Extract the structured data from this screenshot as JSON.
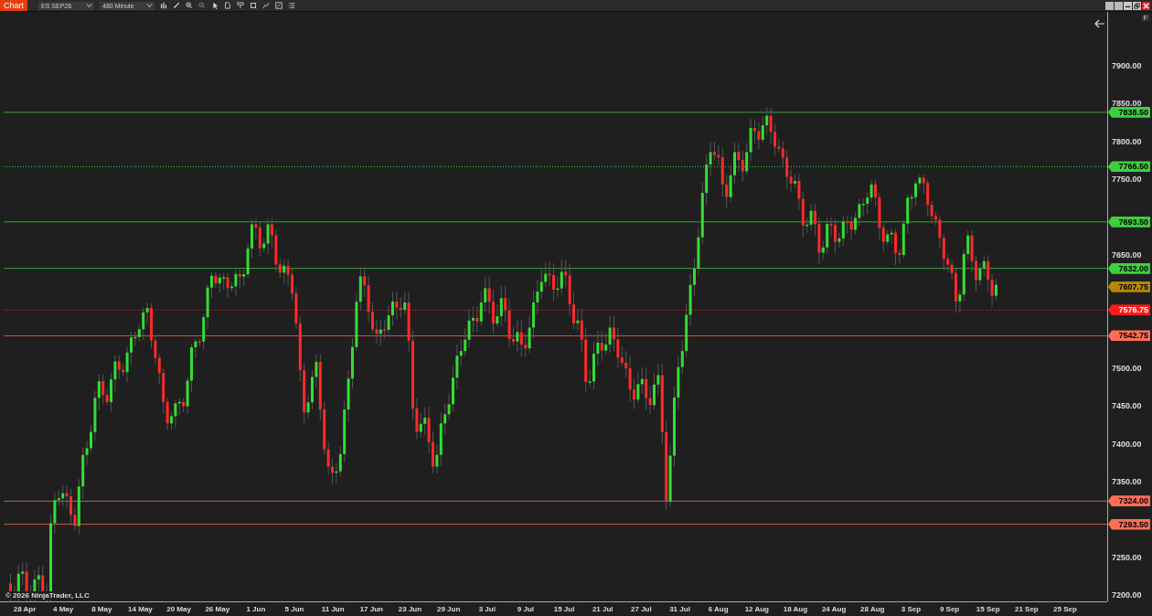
{
  "toolbar": {
    "tab": "Chart",
    "instrument": "ES SEP26",
    "interval": "480 Minute"
  },
  "chart": {
    "flag": "F",
    "price_axis": [
      "7900.00",
      "7850.00",
      "7800.00",
      "7750.00",
      "7650.00",
      "7500.00",
      "7450.00",
      "7400.00",
      "7350.00",
      "7250.00",
      "7200.00"
    ],
    "levels": [
      {
        "label": "7838.50",
        "color": "#3ecf3e",
        "kind": "solid"
      },
      {
        "label": "7766.50",
        "color": "#3ecf3e",
        "kind": "dotted"
      },
      {
        "label": "7693.50",
        "color": "#3ecf3e",
        "kind": "solid"
      },
      {
        "label": "7632.00",
        "color": "#3ecf3e",
        "kind": "solid"
      },
      {
        "label": "7576.75",
        "color": "#ff1a1a",
        "kind": "dotted"
      },
      {
        "label": "7542.75",
        "color": "#ff6e55",
        "kind": "solid"
      },
      {
        "label": "7324.00",
        "color": "#ff6e55",
        "kind": "solid"
      },
      {
        "label": "7293.50",
        "color": "#ff6e55",
        "kind": "solid"
      }
    ],
    "last_price": {
      "label": "7607.75",
      "color": "#b8860b"
    },
    "date_axis": [
      "28 Apr",
      "4 May",
      "8 May",
      "14 May",
      "20 May",
      "26 May",
      "1 Jun",
      "5 Jun",
      "11 Jun",
      "17 Jun",
      "23 Jun",
      "29 Jun",
      "3 Jul",
      "9 Jul",
      "15 Jul",
      "21 Jul",
      "27 Jul",
      "31 Jul",
      "6 Aug",
      "12 Aug",
      "18 Aug",
      "24 Aug",
      "28 Aug",
      "3 Sep",
      "9 Sep",
      "15 Sep",
      "21 Sep",
      "25 Sep"
    ],
    "copyright": "© 2026 NinjaTrader, LLC"
  }
}
